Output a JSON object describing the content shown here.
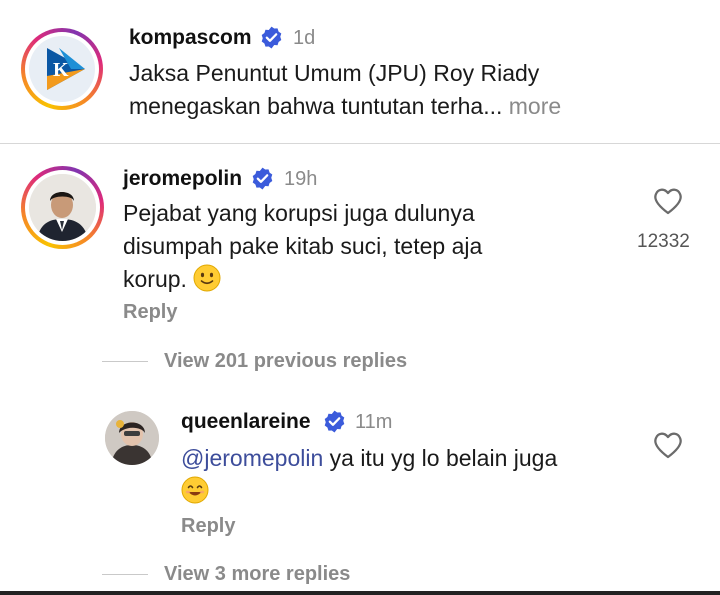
{
  "post": {
    "username": "kompascom",
    "time": "1d",
    "caption_line1": "Jaksa Penuntut Umum (JPU) Roy Riady",
    "caption_line2": "menegaskan bahwa tuntutan terha...",
    "more_label": "more",
    "avatar_letter": "K"
  },
  "comment": {
    "username": "jeromepolin",
    "time": "19h",
    "text_line1": "Pejabat yang korupsi juga dulunya",
    "text_line2": "disumpah pake kitab suci, tetep aja",
    "text_line3": "korup.",
    "reply_label": "Reply",
    "like_count": "12332",
    "view_previous_label": "View 201 previous replies"
  },
  "reply": {
    "username": "queenlareine",
    "time": "11m",
    "mention": "@jeromepolin",
    "text_after_mention": " ya itu yg lo belain juga",
    "reply_label": "Reply",
    "view_more_label": "View 3 more replies"
  },
  "icons": {
    "verified": "verified-badge-icon",
    "heart": "heart-outline-icon",
    "emoji_slight_smile": "slightly-smiling-face-icon",
    "emoji_smile": "smiling-face-icon"
  },
  "colors": {
    "verified": "#3b5bdb",
    "mention": "#3d4d9b",
    "muted": "#8a8a8a"
  }
}
